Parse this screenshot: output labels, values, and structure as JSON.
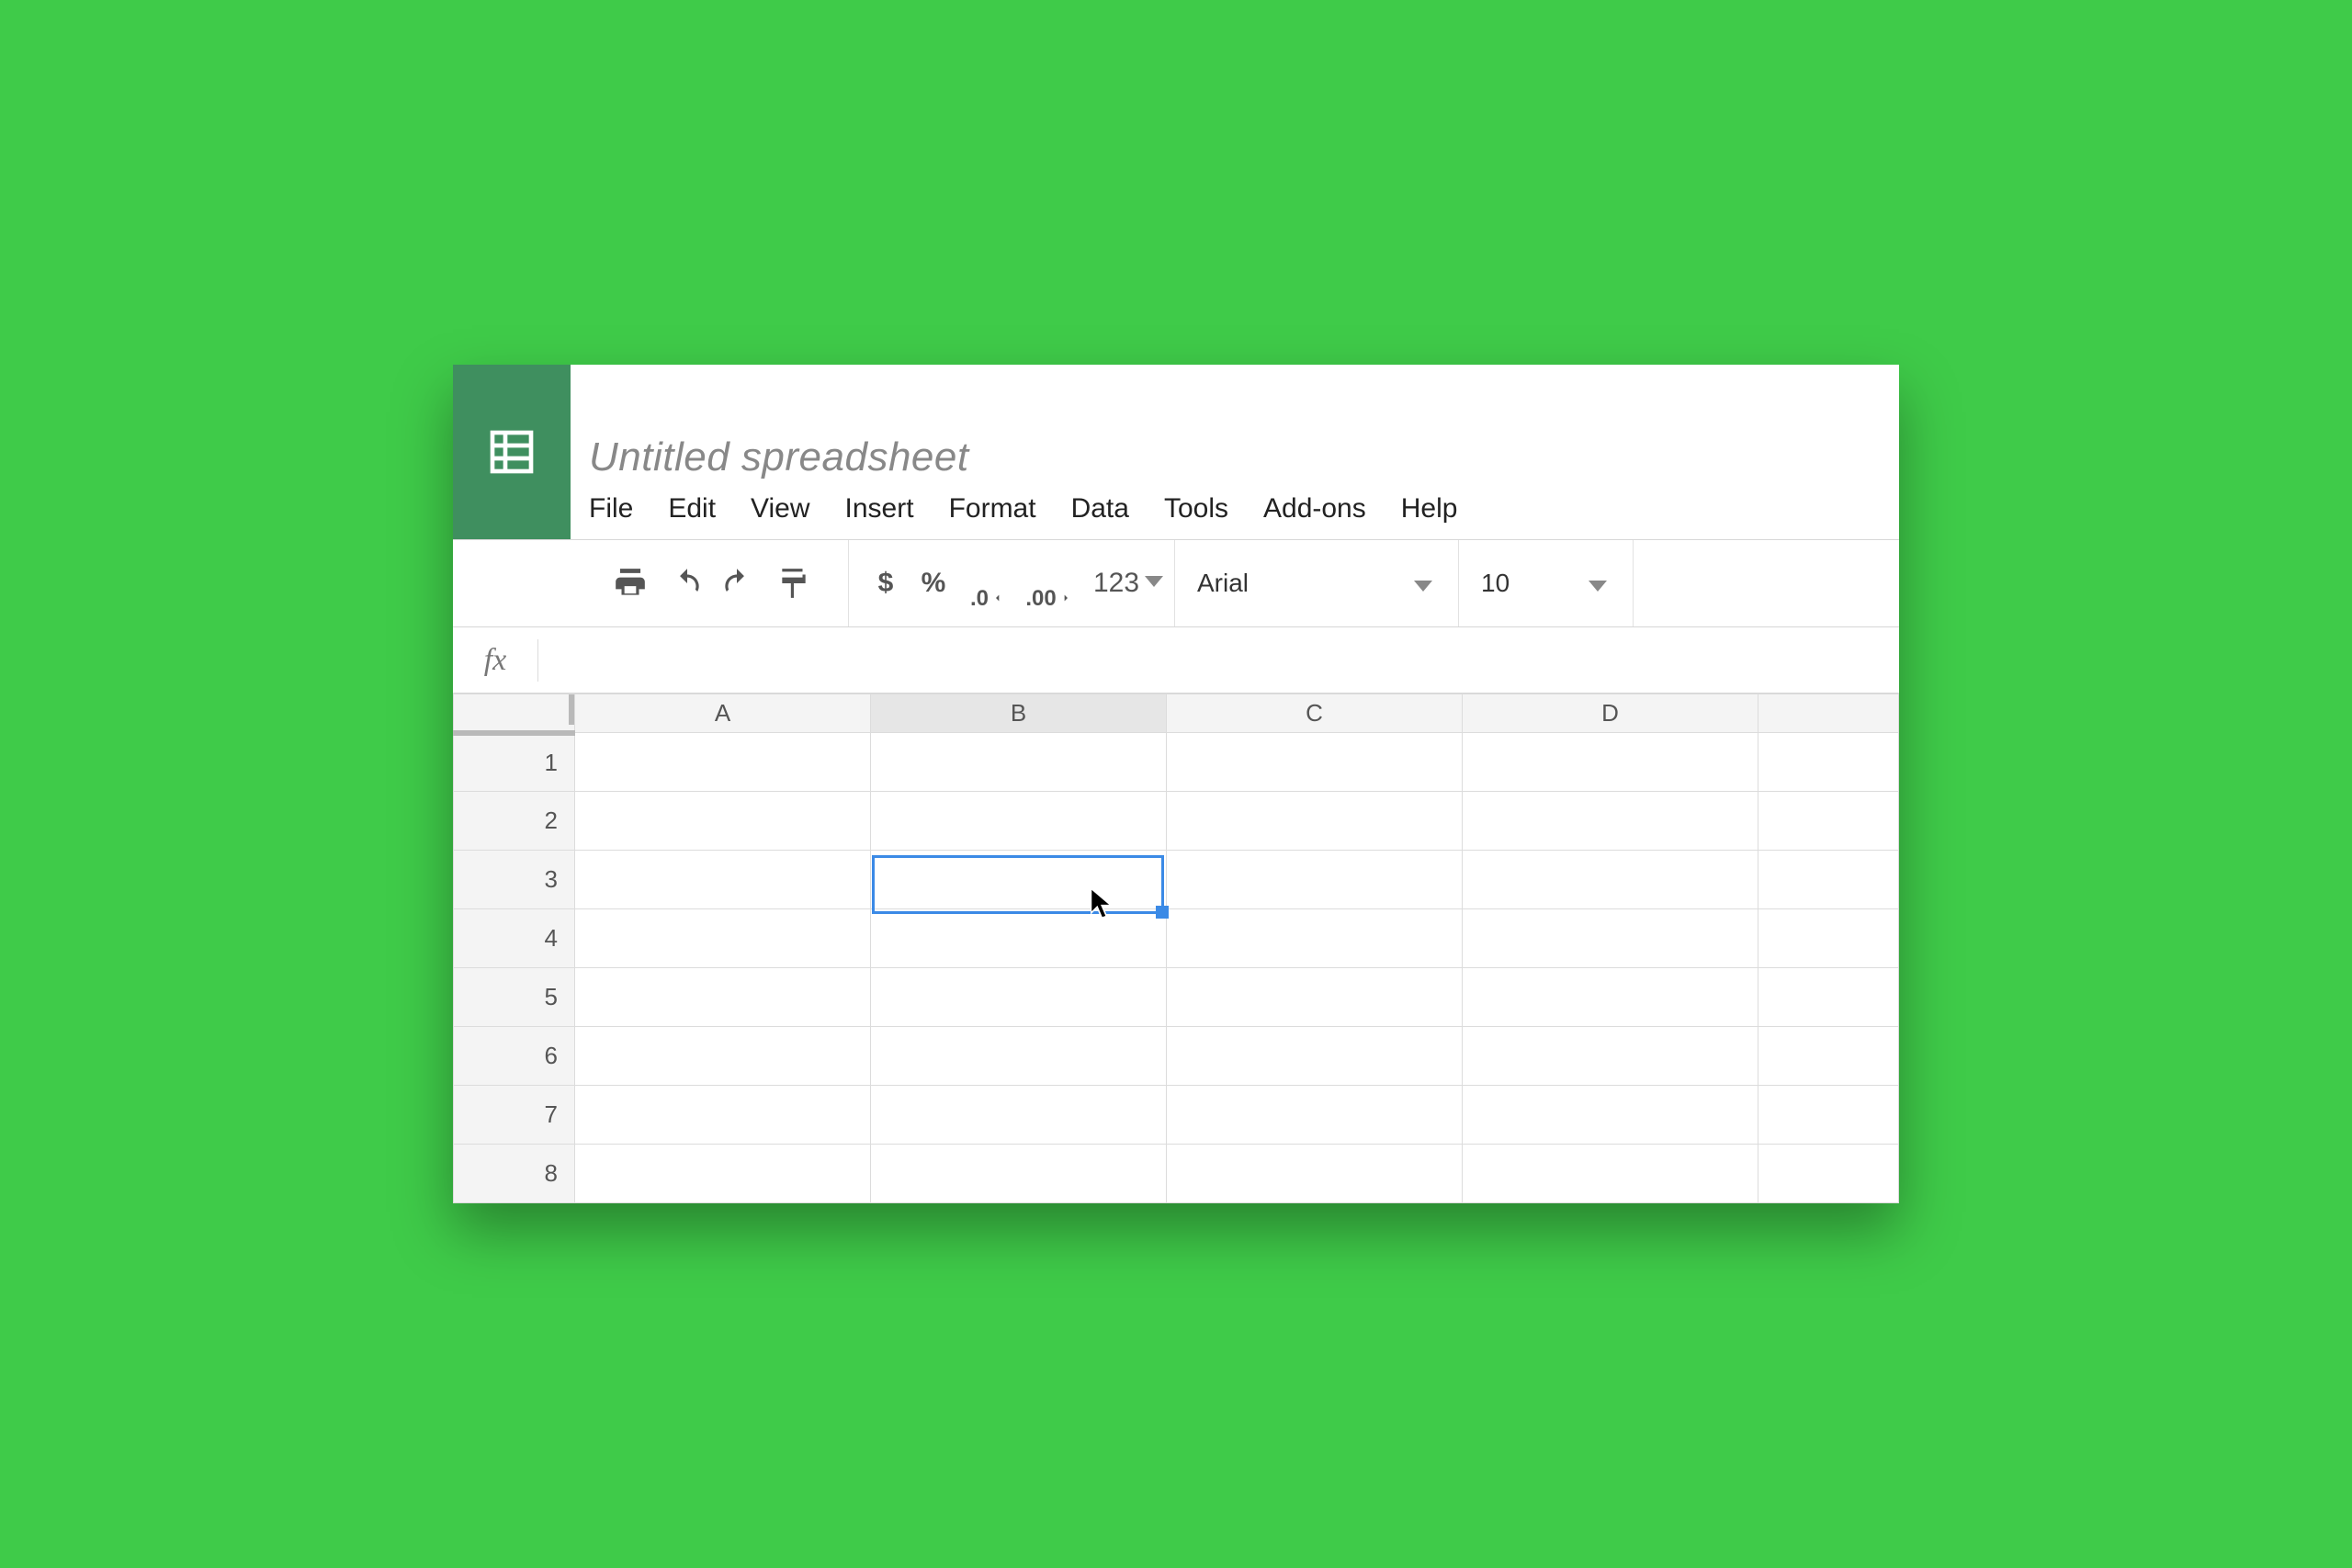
{
  "document": {
    "title": "Untitled spreadsheet"
  },
  "menubar": {
    "file": "File",
    "edit": "Edit",
    "view": "View",
    "insert": "Insert",
    "format": "Format",
    "data": "Data",
    "tools": "Tools",
    "addons": "Add-ons",
    "help": "Help"
  },
  "toolbar": {
    "currency": "$",
    "percent": "%",
    "dec_decrease": ".0",
    "dec_increase": ".00",
    "more_formats": "123",
    "font_name": "Arial",
    "font_size": "10"
  },
  "formula_bar": {
    "label": "fx",
    "value": ""
  },
  "columns": [
    "A",
    "B",
    "C",
    "D"
  ],
  "rows": [
    "1",
    "2",
    "3",
    "4",
    "5",
    "6",
    "7",
    "8"
  ],
  "selected_cell": "B3",
  "selected_column": "B"
}
